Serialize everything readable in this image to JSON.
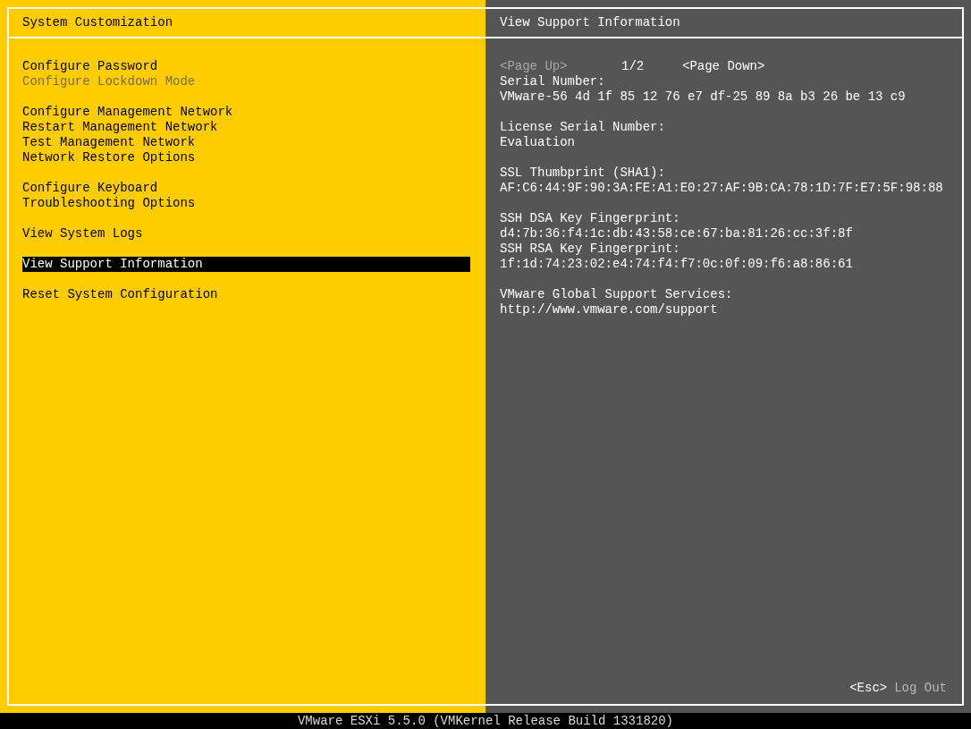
{
  "left_panel": {
    "title": "System Customization",
    "menu_groups": [
      [
        {
          "label": "Configure Password",
          "disabled": false,
          "selected": false
        },
        {
          "label": "Configure Lockdown Mode",
          "disabled": true,
          "selected": false
        }
      ],
      [
        {
          "label": "Configure Management Network",
          "disabled": false,
          "selected": false
        },
        {
          "label": "Restart Management Network",
          "disabled": false,
          "selected": false
        },
        {
          "label": "Test Management Network",
          "disabled": false,
          "selected": false
        },
        {
          "label": "Network Restore Options",
          "disabled": false,
          "selected": false
        }
      ],
      [
        {
          "label": "Configure Keyboard",
          "disabled": false,
          "selected": false
        },
        {
          "label": "Troubleshooting Options",
          "disabled": false,
          "selected": false
        }
      ],
      [
        {
          "label": "View System Logs",
          "disabled": false,
          "selected": false
        }
      ],
      [
        {
          "label": "View Support Information",
          "disabled": false,
          "selected": true
        }
      ],
      [
        {
          "label": "Reset System Configuration",
          "disabled": false,
          "selected": false
        }
      ]
    ]
  },
  "right_panel": {
    "title": "View Support Information",
    "pager": {
      "previous": {
        "label": "<Page Up>",
        "disabled": true
      },
      "page": "1/2",
      "next": {
        "label": "<Page Down>",
        "disabled": false
      }
    },
    "sections": [
      [
        "Serial Number:",
        "VMware-56 4d 1f 85 12 76 e7 df-25 89 8a b3 26 be 13 c9"
      ],
      [
        "License Serial Number:",
        "Evaluation"
      ],
      [
        "SSL Thumbprint (SHA1):",
        "AF:C6:44:9F:90:3A:FE:A1:E0:27:AF:9B:CA:78:1D:7F:E7:5F:98:88"
      ],
      [
        "SSH DSA Key Fingerprint:",
        "d4:7b:36:f4:1c:db:43:58:ce:67:ba:81:26:cc:3f:8f",
        "SSH RSA Key Fingerprint:",
        "1f:1d:74:23:02:e4:74:f4:f7:0c:0f:09:f6:a8:86:61"
      ],
      [
        "VMware Global Support Services:",
        "http://www.vmware.com/support"
      ]
    ],
    "footer": {
      "key": "<Esc>",
      "action": "Log Out"
    }
  },
  "status_bar": "VMware ESXi 5.5.0 (VMKernel Release Build 1331820)"
}
